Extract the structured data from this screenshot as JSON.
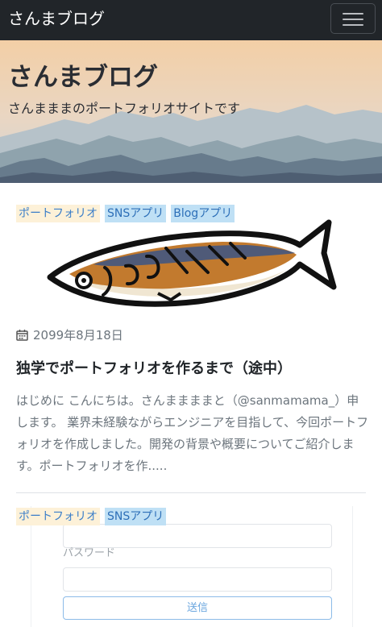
{
  "navbar": {
    "brand": "さんまブログ",
    "menu_icon": "hamburger-icon"
  },
  "hero": {
    "title": "さんまブログ",
    "subtitle": "さんまままのポートフォリオサイトです"
  },
  "post": {
    "tags": [
      "ポートフォリオ",
      "SNSアプリ",
      "Blogアプリ"
    ],
    "image_icon": "saury-fish-illustration",
    "date_icon": "calendar-icon",
    "date": "2099年8月18日",
    "title": "独学でポートフォリオを作るまで（途中）",
    "excerpt": "はじめに こんにちは。さんままままと（@sanmamama_）申します。 業界未経験ながらエンジニアを目指して、今回ポートフォリオを作成しました。開発の背景や概要についてご紹介します。ポートフォリオを作....."
  },
  "next_post": {
    "tags": [
      "ポートフォリオ",
      "SNSアプリ"
    ],
    "form": {
      "password_label": "パスワード",
      "submit_label": "送信"
    }
  },
  "colors": {
    "navbar": "#212529",
    "sky_top": "#f3cfa6",
    "mountain_dark": "#556478",
    "tag_portfolio_bg": "#fdf1d8",
    "tag_app_bg": "#bfe0f5",
    "link": "#2d6fb8"
  }
}
